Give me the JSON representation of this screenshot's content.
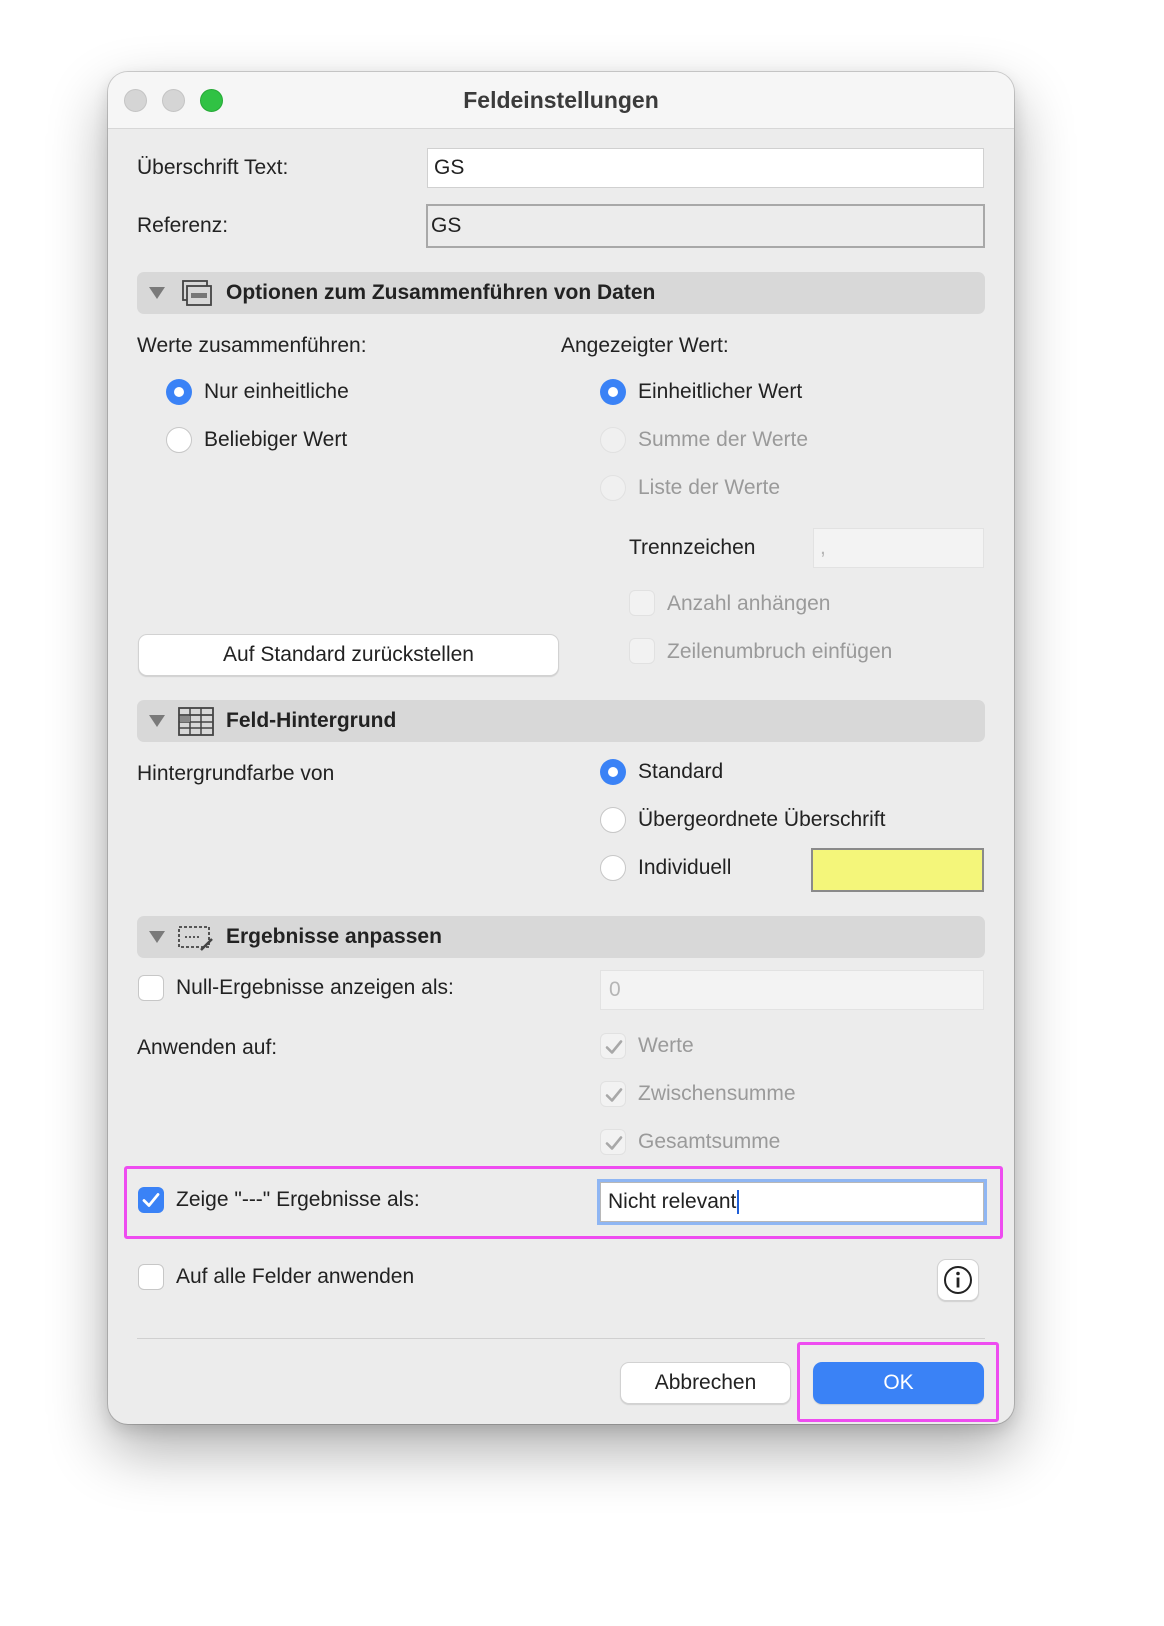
{
  "window": {
    "title": "Feldeinstellungen"
  },
  "fields": {
    "heading_label": "Überschrift Text:",
    "heading_value": "GS",
    "reference_label": "Referenz:",
    "reference_value": "GS"
  },
  "merge_section": {
    "title": "Optionen zum Zusammenführen von Daten",
    "merge_label": "Werte zusammenführen:",
    "merge_options": [
      "Nur einheitliche",
      "Beliebiger Wert"
    ],
    "merge_selected": "Nur einheitliche",
    "display_label": "Angezeigter Wert:",
    "display_options": [
      "Einheitlicher Wert",
      "Summe der Werte",
      "Liste der Werte"
    ],
    "display_selected": "Einheitlicher Wert",
    "separator_label": "Trennzeichen",
    "separator_value": ",",
    "append_count_label": "Anzahl anhängen",
    "line_break_label": "Zeilenumbruch einfügen",
    "reset_button": "Auf Standard zurückstellen"
  },
  "background_section": {
    "title": "Feld-Hintergrund",
    "label": "Hintergrundfarbe von",
    "options": [
      "Standard",
      "Übergeordnete Überschrift",
      "Individuell"
    ],
    "selected": "Standard",
    "custom_color": "#f4f67a"
  },
  "results_section": {
    "title": "Ergebnisse anpassen",
    "null_label": "Null-Ergebnisse anzeigen als:",
    "null_checked": false,
    "null_value": "0",
    "apply_label": "Anwenden auf:",
    "apply_options": [
      "Werte",
      "Zwischensumme",
      "Gesamtsumme"
    ],
    "dash_label": "Zeige \"---\" Ergebnisse als:",
    "dash_checked": true,
    "dash_value": "Nicht relevant",
    "all_fields_label": "Auf alle Felder anwenden",
    "all_fields_checked": false
  },
  "footer": {
    "cancel_button": "Abbrechen",
    "ok_button": "OK"
  },
  "colors": {
    "accent": "#3a82f6",
    "highlight": "#ee4cf0"
  }
}
